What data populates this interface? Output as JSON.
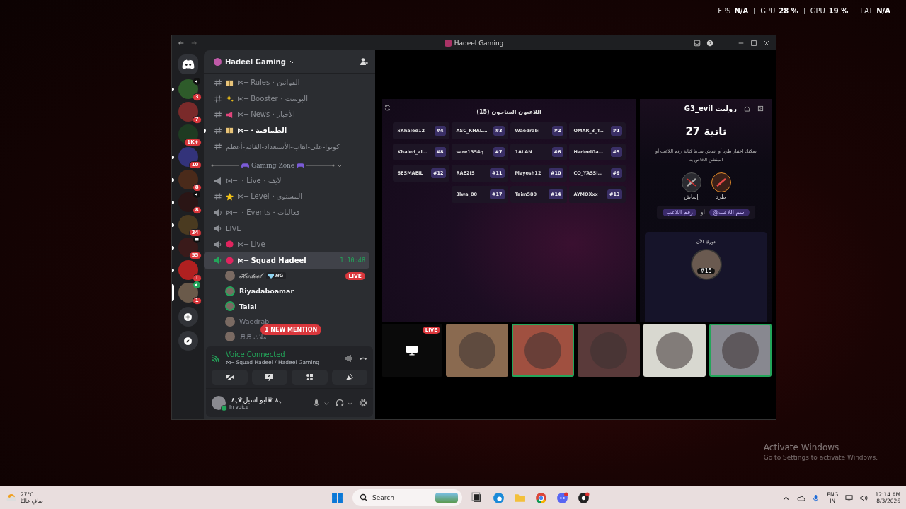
{
  "overlay_stats": [
    {
      "label": "FPS",
      "value": "N/A"
    },
    {
      "label": "GPU",
      "value": "28 %"
    },
    {
      "label": "GPU",
      "value": "19 %"
    },
    {
      "label": "LAT",
      "value": "N/A"
    }
  ],
  "window": {
    "title": "Hadeel Gaming"
  },
  "servers": [
    {
      "badge": "3",
      "voice": true,
      "streaming": false,
      "unread": true,
      "selected": false
    },
    {
      "badge": "7",
      "voice": false,
      "streaming": false,
      "unread": false,
      "selected": false
    },
    {
      "badge": "1K+",
      "voice": false,
      "streaming": false,
      "unread": false,
      "selected": false
    },
    {
      "badge": "10",
      "voice": false,
      "streaming": false,
      "unread": true,
      "selected": false
    },
    {
      "badge": "8",
      "voice": false,
      "streaming": false,
      "unread": true,
      "selected": false
    },
    {
      "badge": "8",
      "voice": true,
      "streaming": false,
      "unread": true,
      "selected": false
    },
    {
      "badge": "34",
      "voice": false,
      "streaming": false,
      "unread": true,
      "selected": false
    },
    {
      "badge": "55",
      "voice": false,
      "streaming": true,
      "unread": true,
      "selected": false
    },
    {
      "badge": "1",
      "voice": false,
      "streaming": false,
      "unread": true,
      "selected": false
    },
    {
      "badge": "1",
      "voice": true,
      "streaming": false,
      "unread": false,
      "selected": true
    }
  ],
  "server": {
    "name": "Hadeel Gaming"
  },
  "channels": [
    {
      "kind": "text",
      "name": "⋈─ Rules・القوانين",
      "unread": false,
      "selected": false
    },
    {
      "kind": "text",
      "name": "⋈─ Booster・البوست",
      "unread": false,
      "selected": false
    },
    {
      "kind": "text",
      "name": "⋈─ News・الأخبار",
      "unread": false,
      "selected": false
    },
    {
      "kind": "text",
      "name": "⋈─・الطماقية",
      "unread": true,
      "selected": false
    },
    {
      "kind": "text",
      "name": "كونوا-على-اهاب-الأستعداد-القائم-أعظم",
      "unread": false,
      "selected": false
    },
    {
      "kind": "category",
      "name": "Gaming Zone"
    },
    {
      "kind": "announce",
      "name": "⋈─ ・Live・لايف",
      "unread": false,
      "selected": false
    },
    {
      "kind": "text",
      "name": "⋈─ Level・المستوى",
      "unread": false,
      "selected": false
    },
    {
      "kind": "stage",
      "name": "⋈─ ・Events・فعاليات",
      "unread": false,
      "selected": false
    },
    {
      "kind": "voice",
      "name": "LIVE",
      "unread": false,
      "selected": false
    },
    {
      "kind": "voice",
      "name": "⋈─ Live",
      "unread": false,
      "selected": false
    },
    {
      "kind": "voice",
      "name": "⋈─ Squad Hadeel",
      "timer": "1:10:48",
      "unread": false,
      "selected": true
    },
    {
      "kind": "user",
      "name": "𝓗𝓪𝓭𝓮𝓮𝓵",
      "tag": "HG",
      "live": "LIVE",
      "speaking": false,
      "dim": false
    },
    {
      "kind": "user",
      "name": "Riyadaboamar",
      "speaking": true,
      "dim": false
    },
    {
      "kind": "user",
      "name": "Talal",
      "speaking": true,
      "dim": false
    },
    {
      "kind": "user",
      "name": "Waedrabi",
      "speaking": false,
      "dim": true
    },
    {
      "kind": "user",
      "name": "♬♬ ملاك",
      "speaking": false,
      "dim": true
    }
  ],
  "mention_pill": "1 NEW MENTION",
  "voice_panel": {
    "status": "Voice Connected",
    "channel": "⋈─ Squad Hadeel / Hadeel Gaming"
  },
  "user": {
    "name": "ﮩ٨ـ♛ابو اسيل♛ﮩ٨ـ",
    "status": "In voice"
  },
  "game": {
    "title": "اللاعبون المتاحون (15)",
    "players": [
      {
        "name": "xKhaled12",
        "number": "#4"
      },
      {
        "name": "ASC_KHAL…",
        "number": "#3"
      },
      {
        "name": "Waedrabi",
        "number": "#2"
      },
      {
        "name": "OMAR_3_T…",
        "number": "#1"
      },
      {
        "name": "Khaled_al…",
        "number": "#8"
      },
      {
        "name": "sare1354q",
        "number": "#7"
      },
      {
        "name": "1ALAN",
        "number": "#6"
      },
      {
        "name": "HadeelGa…",
        "number": "#5"
      },
      {
        "name": "6ESMAEIL",
        "number": "#12"
      },
      {
        "name": "RAE2IS",
        "number": "#11"
      },
      {
        "name": "Mayosh12",
        "number": "#10"
      },
      {
        "name": "CO_YASSI…",
        "number": "#9"
      },
      {
        "name": "3lwa_00",
        "number": "#17"
      },
      {
        "name": "Taim580",
        "number": "#14"
      },
      {
        "name": "AYMOXxx",
        "number": "#13"
      }
    ],
    "panel_title": "G3_evil روليت",
    "timer": "27 ثانية",
    "hint": "يمكنك اختيار طرد أو إنعاش بعدها كتابة رقم اللاعب أو المنشن الخاص به",
    "options": [
      {
        "label": "طرد",
        "selected": true
      },
      {
        "label": "إنعاش",
        "selected": false
      }
    ],
    "chips": [
      {
        "kind": "chip",
        "text": "@اسم اللاعب"
      },
      {
        "kind": "word",
        "text": "أو"
      },
      {
        "kind": "chip",
        "text": "رقم اللاعب"
      }
    ],
    "turn": {
      "title": "دورك الآن",
      "number": "#15"
    }
  },
  "stream_tiles": [
    {
      "kind": "screen",
      "live": "LIVE",
      "speaking": false
    },
    {
      "kind": "avatar",
      "speaking": false
    },
    {
      "kind": "avatar",
      "speaking": true
    },
    {
      "kind": "avatar",
      "speaking": false
    },
    {
      "kind": "avatar",
      "speaking": false
    },
    {
      "kind": "avatar",
      "speaking": true
    }
  ],
  "activation": {
    "title": "Activate Windows",
    "hint": "Go to Settings to activate Windows."
  },
  "taskbar": {
    "temp": "27°C",
    "condition": "صافٍ غالبًا",
    "search": "Search",
    "lang": "ENG",
    "region": "IN",
    "time": "12:14 AM",
    "date": "8/3/2026"
  }
}
